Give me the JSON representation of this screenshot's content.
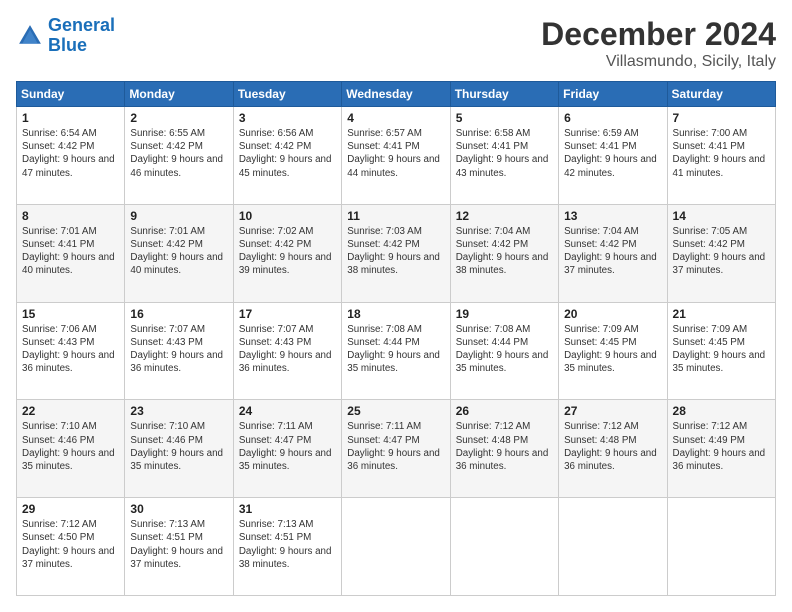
{
  "header": {
    "logo_line1": "General",
    "logo_line2": "Blue",
    "title": "December 2024",
    "subtitle": "Villasmundo, Sicily, Italy"
  },
  "days_of_week": [
    "Sunday",
    "Monday",
    "Tuesday",
    "Wednesday",
    "Thursday",
    "Friday",
    "Saturday"
  ],
  "weeks": [
    [
      {
        "day": "1",
        "info": "Sunrise: 6:54 AM\nSunset: 4:42 PM\nDaylight: 9 hours and 47 minutes."
      },
      {
        "day": "2",
        "info": "Sunrise: 6:55 AM\nSunset: 4:42 PM\nDaylight: 9 hours and 46 minutes."
      },
      {
        "day": "3",
        "info": "Sunrise: 6:56 AM\nSunset: 4:42 PM\nDaylight: 9 hours and 45 minutes."
      },
      {
        "day": "4",
        "info": "Sunrise: 6:57 AM\nSunset: 4:41 PM\nDaylight: 9 hours and 44 minutes."
      },
      {
        "day": "5",
        "info": "Sunrise: 6:58 AM\nSunset: 4:41 PM\nDaylight: 9 hours and 43 minutes."
      },
      {
        "day": "6",
        "info": "Sunrise: 6:59 AM\nSunset: 4:41 PM\nDaylight: 9 hours and 42 minutes."
      },
      {
        "day": "7",
        "info": "Sunrise: 7:00 AM\nSunset: 4:41 PM\nDaylight: 9 hours and 41 minutes."
      }
    ],
    [
      {
        "day": "8",
        "info": "Sunrise: 7:01 AM\nSunset: 4:41 PM\nDaylight: 9 hours and 40 minutes."
      },
      {
        "day": "9",
        "info": "Sunrise: 7:01 AM\nSunset: 4:42 PM\nDaylight: 9 hours and 40 minutes."
      },
      {
        "day": "10",
        "info": "Sunrise: 7:02 AM\nSunset: 4:42 PM\nDaylight: 9 hours and 39 minutes."
      },
      {
        "day": "11",
        "info": "Sunrise: 7:03 AM\nSunset: 4:42 PM\nDaylight: 9 hours and 38 minutes."
      },
      {
        "day": "12",
        "info": "Sunrise: 7:04 AM\nSunset: 4:42 PM\nDaylight: 9 hours and 38 minutes."
      },
      {
        "day": "13",
        "info": "Sunrise: 7:04 AM\nSunset: 4:42 PM\nDaylight: 9 hours and 37 minutes."
      },
      {
        "day": "14",
        "info": "Sunrise: 7:05 AM\nSunset: 4:42 PM\nDaylight: 9 hours and 37 minutes."
      }
    ],
    [
      {
        "day": "15",
        "info": "Sunrise: 7:06 AM\nSunset: 4:43 PM\nDaylight: 9 hours and 36 minutes."
      },
      {
        "day": "16",
        "info": "Sunrise: 7:07 AM\nSunset: 4:43 PM\nDaylight: 9 hours and 36 minutes."
      },
      {
        "day": "17",
        "info": "Sunrise: 7:07 AM\nSunset: 4:43 PM\nDaylight: 9 hours and 36 minutes."
      },
      {
        "day": "18",
        "info": "Sunrise: 7:08 AM\nSunset: 4:44 PM\nDaylight: 9 hours and 35 minutes."
      },
      {
        "day": "19",
        "info": "Sunrise: 7:08 AM\nSunset: 4:44 PM\nDaylight: 9 hours and 35 minutes."
      },
      {
        "day": "20",
        "info": "Sunrise: 7:09 AM\nSunset: 4:45 PM\nDaylight: 9 hours and 35 minutes."
      },
      {
        "day": "21",
        "info": "Sunrise: 7:09 AM\nSunset: 4:45 PM\nDaylight: 9 hours and 35 minutes."
      }
    ],
    [
      {
        "day": "22",
        "info": "Sunrise: 7:10 AM\nSunset: 4:46 PM\nDaylight: 9 hours and 35 minutes."
      },
      {
        "day": "23",
        "info": "Sunrise: 7:10 AM\nSunset: 4:46 PM\nDaylight: 9 hours and 35 minutes."
      },
      {
        "day": "24",
        "info": "Sunrise: 7:11 AM\nSunset: 4:47 PM\nDaylight: 9 hours and 35 minutes."
      },
      {
        "day": "25",
        "info": "Sunrise: 7:11 AM\nSunset: 4:47 PM\nDaylight: 9 hours and 36 minutes."
      },
      {
        "day": "26",
        "info": "Sunrise: 7:12 AM\nSunset: 4:48 PM\nDaylight: 9 hours and 36 minutes."
      },
      {
        "day": "27",
        "info": "Sunrise: 7:12 AM\nSunset: 4:48 PM\nDaylight: 9 hours and 36 minutes."
      },
      {
        "day": "28",
        "info": "Sunrise: 7:12 AM\nSunset: 4:49 PM\nDaylight: 9 hours and 36 minutes."
      }
    ],
    [
      {
        "day": "29",
        "info": "Sunrise: 7:12 AM\nSunset: 4:50 PM\nDaylight: 9 hours and 37 minutes."
      },
      {
        "day": "30",
        "info": "Sunrise: 7:13 AM\nSunset: 4:51 PM\nDaylight: 9 hours and 37 minutes."
      },
      {
        "day": "31",
        "info": "Sunrise: 7:13 AM\nSunset: 4:51 PM\nDaylight: 9 hours and 38 minutes."
      },
      {
        "day": "",
        "info": ""
      },
      {
        "day": "",
        "info": ""
      },
      {
        "day": "",
        "info": ""
      },
      {
        "day": "",
        "info": ""
      }
    ]
  ]
}
